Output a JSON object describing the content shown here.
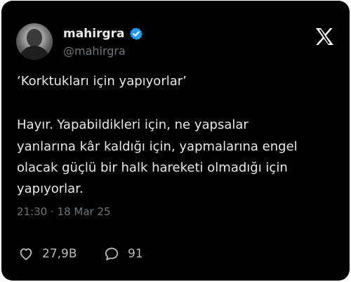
{
  "tweet": {
    "author": {
      "display_name": "mahirgra",
      "handle": "@mahirgra",
      "verified": true
    },
    "text_lines": [
      "‘Korktukları için yapıyorlar’",
      "Hayır. Yapabildikleri için, ne yapsalar",
      "yanlarına kâr kaldığı için, yapmalarına engel",
      "olacak güçlü bir halk hareketi olmadığı için",
      "yapıyorlar."
    ],
    "timestamp": "21:30 · 18 Mar 25",
    "likes": "27,9B",
    "replies": "91"
  },
  "icons": {
    "verified": "verified-badge-icon",
    "logo": "x-logo-icon",
    "like": "heart-icon",
    "reply": "reply-bubble-icon"
  },
  "colors": {
    "background": "#000000",
    "text": "#e7e9ea",
    "secondary_text": "#71767b",
    "verified_blue": "#1d9bf0"
  }
}
